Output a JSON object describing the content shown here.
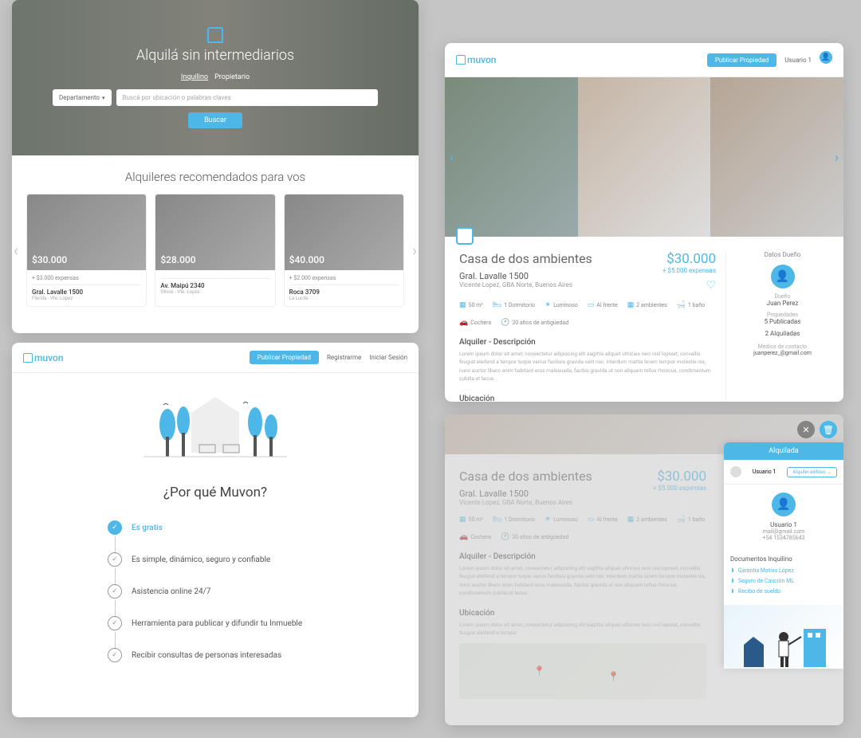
{
  "brand": "muvon",
  "hero": {
    "title": "Alquilá sin intermediarios",
    "tab1": "Inquilino",
    "tab2": "Propietario",
    "select": "Departamento",
    "placeholder": "Buscá por ubicación o palabras claves",
    "button": "Buscar"
  },
  "recTitle": "Alquileres recomendados para vos",
  "cards": [
    {
      "price": "$30.000",
      "exp": "+ $3.000 expensas",
      "addr": "Gral. Lavalle 1500",
      "loc": "Florida - Vte. Lopez"
    },
    {
      "price": "$28.000",
      "exp": "",
      "addr": "Av. Maipú 2340",
      "loc": "Olivos - Vte. Lopez"
    },
    {
      "price": "$40.000",
      "exp": "+ $2.000 expensas",
      "addr": "Roca 3709",
      "loc": "La Lucila"
    }
  ],
  "nav": {
    "publish": "Publicar Propiedad",
    "register": "Registrarme",
    "login": "Iniciar Sesión",
    "user": "Usuario 1"
  },
  "why": {
    "title": "¿Por qué Muvon?",
    "steps": [
      "Es gratis",
      "Es simple, dinámico, seguro y confiable",
      "Asistencia online 24/7",
      "Herramienta para publicar y difundir tu Inmueble",
      "Recibir consultas de personas interesadas"
    ]
  },
  "detail": {
    "title": "Casa de dos ambientes",
    "addr": "Gral. Lavalle 1500",
    "loc": "Vicente Lopez, GBA Norte, Buenos Aires",
    "price": "$30.000",
    "expenses": "+ $5.000 expensas",
    "specs": [
      "50 m²",
      "1 Dormitorio",
      "Luminoso",
      "Al frente",
      "2 ambientes",
      "1 baño",
      "Cochera",
      "30 años de antigüedad"
    ],
    "descH": "Alquiler - Descripción",
    "desc": "Lorem ipsum dolor sit amet, consectetur adipiscing elit sagittis aliquet ultricies neci nisl lopreet, convallis feugiat eleifend a tempor turpis varius facilisis gravida velit nisi. Interdum mattis lorem tempor molestie nis, nunc auctor libero enim habitant eros malesuada, facilisi gravida ut non aliquam tellus rhoncus, condimentum cubilia et lacus.",
    "ubicH": "Ubicación",
    "ubic": "Lorem ipsum dolor sit amet, consectetur adipiscing elit sagittis aliquet ultricies neci nisl lopreet, convallis feugiat eleifend a tempor."
  },
  "owner": {
    "head": "Datos Dueño",
    "lbl": "Dueño",
    "name": "Juan Perez",
    "propsLbl": "Propiedades",
    "pub": "5 Publicadas",
    "rent": "2 Alquiladas",
    "contactH": "Medios de contacto",
    "email": "juanperez_@gmail.com"
  },
  "side": {
    "status": "Alquilada",
    "user": "Usuario 1",
    "btn": "Alquiler exitoso →",
    "name": "Usuario 1",
    "email": "mail@gmail.com",
    "phone": "+54 1534785643",
    "docsH": "Documentos Inquilino",
    "docs": [
      "Garantía Matías López",
      "Seguro de Caución ML",
      "Recibo de sueldo"
    ]
  }
}
